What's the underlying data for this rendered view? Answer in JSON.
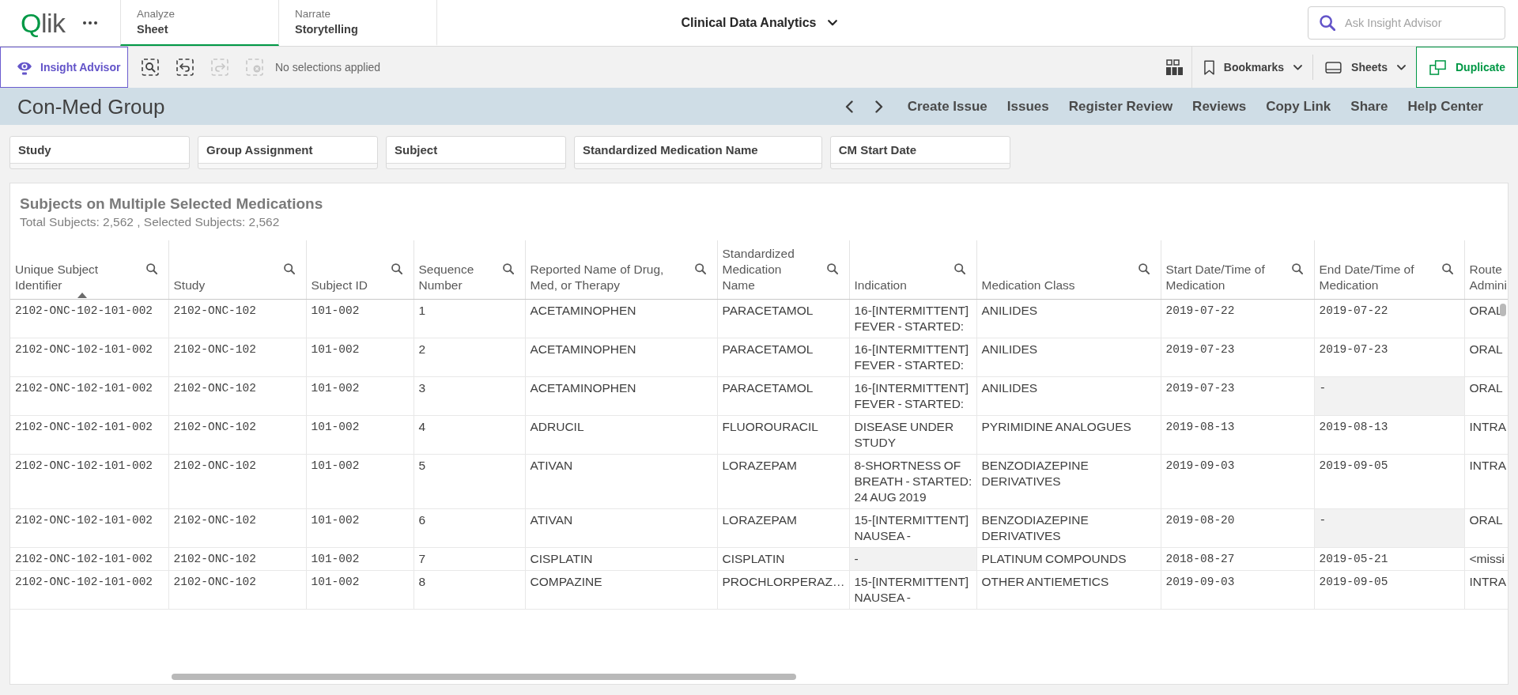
{
  "top_bar": {
    "logo": "Qlik",
    "tabs": [
      {
        "label": "Analyze",
        "title": "Sheet",
        "selected": true
      },
      {
        "label": "Narrate",
        "title": "Storytelling",
        "selected": false
      }
    ],
    "app_title": "Clinical Data Analytics",
    "search": {
      "placeholder": "Ask Insight Advisor"
    }
  },
  "toolbar": {
    "insight_advisor": "Insight Advisor",
    "selection_tools": [
      {
        "kind": "smart-search",
        "disabled": false
      },
      {
        "kind": "step-back",
        "disabled": false
      },
      {
        "kind": "step-forward",
        "disabled": true
      },
      {
        "kind": "clear",
        "disabled": true
      }
    ],
    "selections_status": "No selections applied",
    "menus": [
      {
        "kind": "bookmarks",
        "label": "Bookmarks"
      },
      {
        "kind": "sheets",
        "label": "Sheets"
      }
    ],
    "duplicate": "Duplicate"
  },
  "sheet_header": {
    "title": "Con-Med Group",
    "links": [
      "Create Issue",
      "Issues",
      "Register Review",
      "Reviews",
      "Copy Link",
      "Share",
      "Help Center"
    ]
  },
  "filters": [
    "Study",
    "Group Assignment",
    "Subject",
    "Standardized Medication Name",
    "CM Start Date"
  ],
  "table": {
    "title": "Subjects on Multiple Selected Medications",
    "subtitle": "Total Subjects: 2,562 , Selected Subjects: 2,562",
    "columns": [
      {
        "label": "Unique Subject Identifier",
        "kind": "code",
        "sorted": true,
        "search_icon": true
      },
      {
        "label": "Study",
        "kind": "code",
        "sorted": false,
        "search_icon": true
      },
      {
        "label": "Subject ID",
        "kind": "code",
        "sorted": false,
        "search_icon": true
      },
      {
        "label": "Sequence Number",
        "kind": "text",
        "sorted": false,
        "search_icon": true
      },
      {
        "label": "Reported Name of Drug, Med, or Therapy",
        "kind": "text",
        "sorted": false,
        "search_icon": true
      },
      {
        "label": "Standardized Medication Name",
        "kind": "text",
        "sorted": false,
        "search_icon": true
      },
      {
        "label": "Indication",
        "kind": "text",
        "sorted": false,
        "search_icon": true
      },
      {
        "label": "Medication Class",
        "kind": "text",
        "sorted": false,
        "search_icon": true
      },
      {
        "label": "Start Date/Time of Medication",
        "kind": "code",
        "sorted": false,
        "search_icon": true
      },
      {
        "label": "End Date/Time of Medication",
        "kind": "code",
        "sorted": false,
        "search_icon": true
      },
      {
        "label": "Route Admini",
        "kind": "text",
        "sorted": false,
        "search_icon": false
      }
    ],
    "rows": [
      [
        {
          "text": "2102-ONC-102-101-002",
          "null": false
        },
        {
          "text": "2102-ONC-102",
          "null": false
        },
        {
          "text": "101-002",
          "null": false
        },
        {
          "text": "1",
          "null": false
        },
        {
          "text": "ACETAMINOPHEN",
          "null": false
        },
        {
          "text": "PARACETAMOL",
          "null": false
        },
        {
          "text": "16-[INTERMITTENT] FEVER - STARTED:",
          "null": false
        },
        {
          "text": "ANILIDES",
          "null": false
        },
        {
          "text": "2019-07-22",
          "null": false
        },
        {
          "text": "2019-07-22",
          "null": false
        },
        {
          "text": "ORAL",
          "null": false
        }
      ],
      [
        {
          "text": "2102-ONC-102-101-002",
          "null": false
        },
        {
          "text": "2102-ONC-102",
          "null": false
        },
        {
          "text": "101-002",
          "null": false
        },
        {
          "text": "2",
          "null": false
        },
        {
          "text": "ACETAMINOPHEN",
          "null": false
        },
        {
          "text": "PARACETAMOL",
          "null": false
        },
        {
          "text": "16-[INTERMITTENT] FEVER - STARTED:",
          "null": false
        },
        {
          "text": "ANILIDES",
          "null": false
        },
        {
          "text": "2019-07-23",
          "null": false
        },
        {
          "text": "2019-07-23",
          "null": false
        },
        {
          "text": "ORAL",
          "null": false
        }
      ],
      [
        {
          "text": "2102-ONC-102-101-002",
          "null": false
        },
        {
          "text": "2102-ONC-102",
          "null": false
        },
        {
          "text": "101-002",
          "null": false
        },
        {
          "text": "3",
          "null": false
        },
        {
          "text": "ACETAMINOPHEN",
          "null": false
        },
        {
          "text": "PARACETAMOL",
          "null": false
        },
        {
          "text": "16-[INTERMITTENT] FEVER - STARTED:",
          "null": false
        },
        {
          "text": "ANILIDES",
          "null": false
        },
        {
          "text": "2019-07-23",
          "null": false
        },
        {
          "text": "-",
          "null": true
        },
        {
          "text": "ORAL",
          "null": false
        }
      ],
      [
        {
          "text": "2102-ONC-102-101-002",
          "null": false
        },
        {
          "text": "2102-ONC-102",
          "null": false
        },
        {
          "text": "101-002",
          "null": false
        },
        {
          "text": "4",
          "null": false
        },
        {
          "text": "ADRUCIL",
          "null": false
        },
        {
          "text": "FLUOROURACIL",
          "null": false
        },
        {
          "text": "DISEASE UNDER STUDY",
          "null": false
        },
        {
          "text": "PYRIMIDINE ANALOGUES",
          "null": false
        },
        {
          "text": "2019-08-13",
          "null": false
        },
        {
          "text": "2019-08-13",
          "null": false
        },
        {
          "text": "INTRA",
          "null": false
        }
      ],
      [
        {
          "text": "2102-ONC-102-101-002",
          "null": false
        },
        {
          "text": "2102-ONC-102",
          "null": false
        },
        {
          "text": "101-002",
          "null": false
        },
        {
          "text": "5",
          "null": false
        },
        {
          "text": "ATIVAN",
          "null": false
        },
        {
          "text": "LORAZEPAM",
          "null": false
        },
        {
          "text": "8-SHORTNESS OF BREATH - STARTED: 24 AUG 2019",
          "null": false
        },
        {
          "text": "BENZODIAZEPINE DERIVATIVES",
          "null": false
        },
        {
          "text": "2019-09-03",
          "null": false
        },
        {
          "text": "2019-09-05",
          "null": false
        },
        {
          "text": "INTRA",
          "null": false
        }
      ],
      [
        {
          "text": "2102-ONC-102-101-002",
          "null": false
        },
        {
          "text": "2102-ONC-102",
          "null": false
        },
        {
          "text": "101-002",
          "null": false
        },
        {
          "text": "6",
          "null": false
        },
        {
          "text": "ATIVAN",
          "null": false
        },
        {
          "text": "LORAZEPAM",
          "null": false
        },
        {
          "text": "15-[INTERMITTENT] NAUSEA -",
          "null": false
        },
        {
          "text": "BENZODIAZEPINE DERIVATIVES",
          "null": false
        },
        {
          "text": "2019-08-20",
          "null": false
        },
        {
          "text": "-",
          "null": true
        },
        {
          "text": "ORAL",
          "null": false
        }
      ],
      [
        {
          "text": "2102-ONC-102-101-002",
          "null": false
        },
        {
          "text": "2102-ONC-102",
          "null": false
        },
        {
          "text": "101-002",
          "null": false
        },
        {
          "text": "7",
          "null": false
        },
        {
          "text": "CISPLATIN",
          "null": false
        },
        {
          "text": "CISPLATIN",
          "null": false
        },
        {
          "text": "-",
          "null": true
        },
        {
          "text": "PLATINUM COMPOUNDS",
          "null": false
        },
        {
          "text": "2018-08-27",
          "null": false
        },
        {
          "text": "2019-05-21",
          "null": false
        },
        {
          "text": "<missi",
          "null": false
        }
      ],
      [
        {
          "text": "2102-ONC-102-101-002",
          "null": false
        },
        {
          "text": "2102-ONC-102",
          "null": false
        },
        {
          "text": "101-002",
          "null": false
        },
        {
          "text": "8",
          "null": false
        },
        {
          "text": "COMPAZINE",
          "null": false
        },
        {
          "text": "PROCHLORPERAZ…",
          "null": false
        },
        {
          "text": "15-[INTERMITTENT] NAUSEA -",
          "null": false
        },
        {
          "text": "OTHER ANTIEMETICS",
          "null": false
        },
        {
          "text": "2019-09-03",
          "null": false
        },
        {
          "text": "2019-09-05",
          "null": false
        },
        {
          "text": "INTRA",
          "null": false
        }
      ]
    ]
  }
}
